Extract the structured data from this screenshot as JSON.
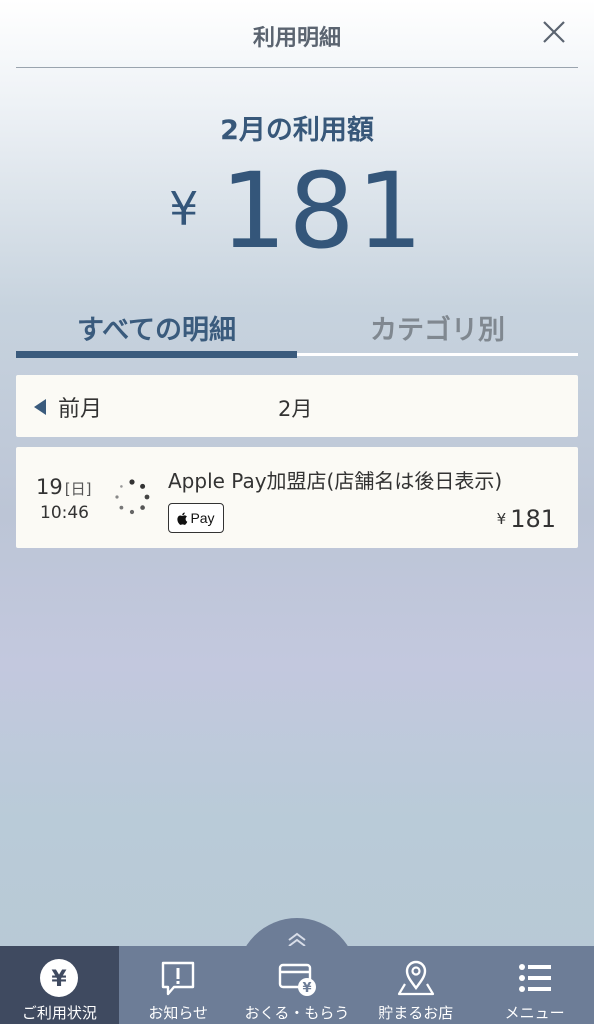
{
  "header": {
    "title": "利用明細"
  },
  "summary": {
    "month_label": "2月の利用額",
    "currency_symbol": "¥",
    "amount": "181"
  },
  "tabs": [
    {
      "label": "すべての明細",
      "active": true
    },
    {
      "label": "カテゴリ別",
      "active": false
    }
  ],
  "month_nav": {
    "prev_label": "前月",
    "current_month": "2月"
  },
  "transactions": [
    {
      "day": "19",
      "weekday": "[日]",
      "time": "10:46",
      "merchant": "Apple Pay加盟店(店舗名は後日表示)",
      "payment_badge": "Pay",
      "currency_symbol": "¥",
      "amount": "181"
    }
  ],
  "bottom_nav": [
    {
      "label": "ご利用状況",
      "icon": "yen-circle-icon",
      "active": true
    },
    {
      "label": "お知らせ",
      "icon": "notice-icon",
      "active": false
    },
    {
      "label": "おくる・もらう",
      "icon": "card-send-icon",
      "active": false
    },
    {
      "label": "貯まるお店",
      "icon": "map-pin-icon",
      "active": false
    },
    {
      "label": "メニュー",
      "icon": "menu-list-icon",
      "active": false
    }
  ],
  "colors": {
    "primary": "#3a5b7d",
    "nav_bg": "#6d7d97",
    "nav_active": "#3f4a60",
    "card_bg": "#fbfaf5"
  }
}
